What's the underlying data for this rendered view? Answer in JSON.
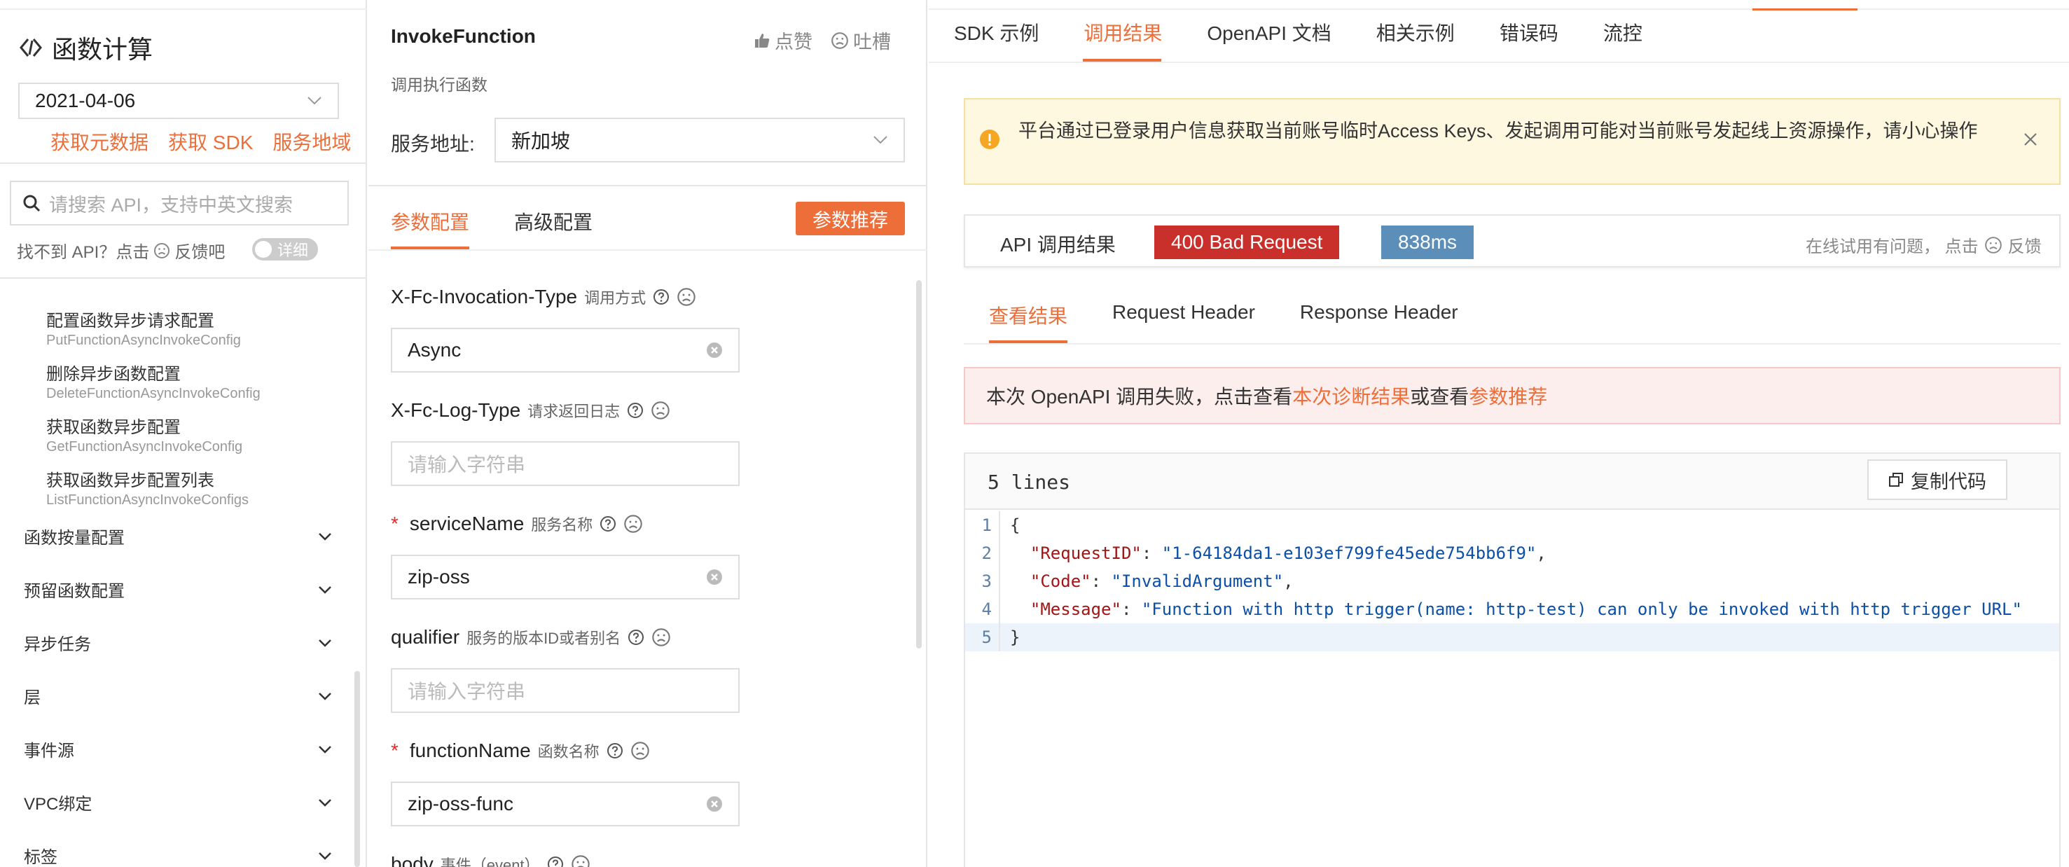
{
  "left": {
    "app_title": "函数计算",
    "date": "2021-04-06",
    "links": [
      "获取元数据",
      "获取 SDK",
      "服务地域"
    ],
    "search_placeholder": "请搜索 API，支持中英文搜索",
    "hint_prefix": "找不到 API？点击",
    "hint_suffix": "反馈吧",
    "toggle_label": "详细",
    "sub_items": [
      {
        "name": "配置函数异步请求配置",
        "api": "PutFunctionAsyncInvokeConfig"
      },
      {
        "name": "删除异步函数配置",
        "api": "DeleteFunctionAsyncInvokeConfig"
      },
      {
        "name": "获取函数异步配置",
        "api": "GetFunctionAsyncInvokeConfig"
      },
      {
        "name": "获取函数异步配置列表",
        "api": "ListFunctionAsyncInvokeConfigs"
      }
    ],
    "groups": [
      "函数按量配置",
      "预留函数配置",
      "异步任务",
      "层",
      "事件源",
      "VPC绑定",
      "标签"
    ]
  },
  "middle": {
    "function_title": "InvokeFunction",
    "function_subtitle": "调用执行函数",
    "like": "点赞",
    "complain": "吐槽",
    "service_label": "服务地址:",
    "service_value": "新加坡",
    "tab_params": "参数配置",
    "tab_advanced": "高级配置",
    "recommend_button": "参数推荐",
    "fields": [
      {
        "name": "X-Fc-Invocation-Type",
        "zh": "调用方式",
        "required": false,
        "value": "Async",
        "placeholder": ""
      },
      {
        "name": "X-Fc-Log-Type",
        "zh": "请求返回日志",
        "required": false,
        "value": "",
        "placeholder": "请输入字符串"
      },
      {
        "name": "serviceName",
        "zh": "服务名称",
        "required": true,
        "value": "zip-oss",
        "placeholder": ""
      },
      {
        "name": "qualifier",
        "zh": "服务的版本ID或者别名",
        "required": false,
        "value": "",
        "placeholder": "请输入字符串"
      },
      {
        "name": "functionName",
        "zh": "函数名称",
        "required": true,
        "value": "zip-oss-func",
        "placeholder": ""
      },
      {
        "name": "body",
        "zh": "事件（event）",
        "required": false,
        "value": "",
        "placeholder": ""
      }
    ]
  },
  "right": {
    "tabs": [
      "SDK 示例",
      "调用结果",
      "OpenAPI 文档",
      "相关示例",
      "错误码",
      "流控"
    ],
    "active_tab": "调用结果",
    "alert_text": "平台通过已登录用户信息获取当前账号临时Access Keys、发起调用可能对当前账号发起线上资源操作，请小心操作",
    "result_label": "API 调用结果",
    "status": "400 Bad Request",
    "time": "838ms",
    "result_feedback_prefix": "在线试用有问题，  点击",
    "result_feedback_suffix": "反馈",
    "sub_tabs": [
      "查看结果",
      "Request Header",
      "Response Header"
    ],
    "error_prefix": "本次 OpenAPI 调用失败，点击查看",
    "error_link1": "本次诊断结果",
    "error_middle": "或查看",
    "error_link2": "参数推荐",
    "lines_count": "5 lines",
    "copy_button": "复制代码",
    "code": {
      "request_id_key": "\"RequestID\"",
      "request_id_val": "\"1-64184da1-e103ef799fe45ede754bb6f9\"",
      "code_key": "\"Code\"",
      "code_val": "\"InvalidArgument\"",
      "message_key": "\"Message\"",
      "message_val": "\"Function with http trigger(name: http-test) can only be invoked with http trigger URL\""
    },
    "line_numbers": [
      "1",
      "2",
      "3",
      "4",
      "5"
    ]
  },
  "colors": {
    "accent": "#ee6e39",
    "error_status": "#c9302c",
    "time_badge": "#5b8fb9"
  }
}
